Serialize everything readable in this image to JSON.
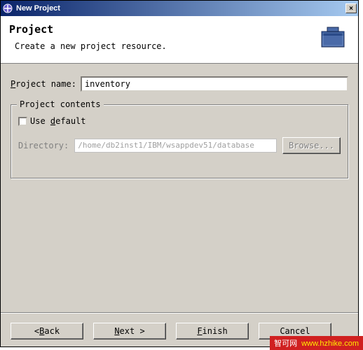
{
  "window": {
    "title": "New Project",
    "close_glyph": "×"
  },
  "banner": {
    "heading": "Project",
    "description": "Create a new project resource."
  },
  "form": {
    "project_name_label": "Project name:",
    "project_name_key": "P",
    "project_name_value": "inventory"
  },
  "group": {
    "legend": "Project contents",
    "use_default_label": "Use default",
    "use_default_key": "d",
    "use_default_checked": false,
    "directory_label": "Directory:",
    "directory_value": "/home/db2inst1/IBM/wsappdev51/database",
    "browse_label": "Browse..."
  },
  "buttons": {
    "back": "< Back",
    "back_key": "B",
    "next": "Next >",
    "next_key": "N",
    "finish": "Finish",
    "finish_key": "F",
    "cancel": "Cancel"
  },
  "watermark": {
    "cn": "智可网",
    "url": "www.hzhike.com"
  }
}
